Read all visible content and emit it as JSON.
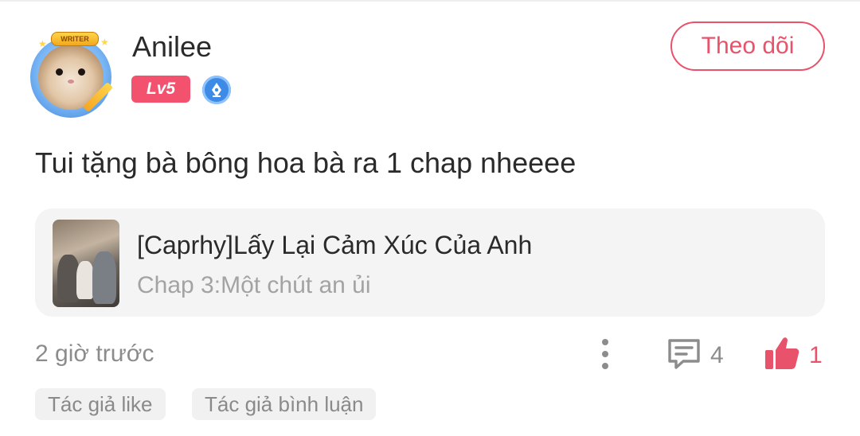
{
  "user": {
    "name": "Anilee",
    "level": "Lv5",
    "avatar_badge": "WRITER",
    "writer_badge_icon": "writer-pen-icon"
  },
  "actions": {
    "follow_label": "Theo dõi"
  },
  "comment": {
    "text": "Tui tặng bà bông hoa bà ra 1 chap nheeee"
  },
  "chapter_card": {
    "title": "[Caprhy]Lấy Lại Cảm Xúc Của Anh",
    "subtitle": "Chap 3:Một chút an ủi"
  },
  "footer": {
    "timestamp": "2 giờ trước",
    "comment_count": "4",
    "like_count": "1",
    "tags": [
      "Tác giả like",
      "Tác giả bình luận"
    ]
  },
  "colors": {
    "accent": "#e8526b",
    "level_badge": "#f2526d",
    "writer_badge": "#3d8be6",
    "muted_text": "#8c8c8c",
    "card_bg": "#f4f4f4"
  }
}
